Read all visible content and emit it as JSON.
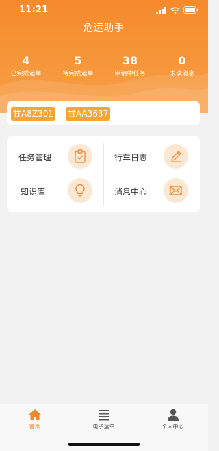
{
  "status_bar": {
    "time": "11:21"
  },
  "header": {
    "title": "危运助手"
  },
  "stats": [
    {
      "value": "4",
      "label": "已完成运单"
    },
    {
      "value": "5",
      "label": "待完成运单"
    },
    {
      "value": "38",
      "label": "申请中任务"
    },
    {
      "value": "0",
      "label": "未读消息"
    }
  ],
  "plates": [
    "甘A8Z301",
    "甘AA3637"
  ],
  "menu": {
    "task": "任务管理",
    "log": "行车日志",
    "knowledge": "知识库",
    "messages": "消息中心"
  },
  "tabs": [
    {
      "label": "首页",
      "icon": "home-icon"
    },
    {
      "label": "电子运单",
      "icon": "list-icon"
    },
    {
      "label": "个人中心",
      "icon": "person-icon"
    }
  ],
  "colors": {
    "accent": "#f5892a",
    "plate": "#f5a532",
    "icon_bg": "#fbe7d2"
  }
}
